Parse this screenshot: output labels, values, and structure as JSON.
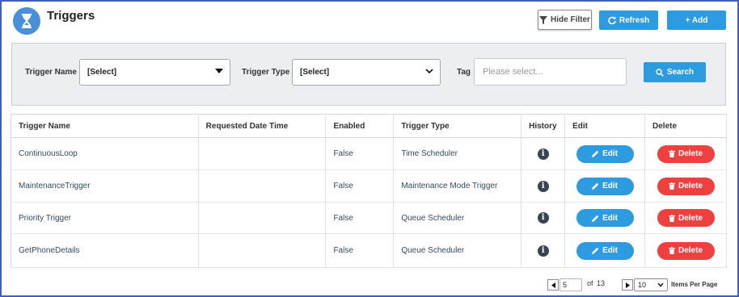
{
  "header": {
    "title": "Triggers",
    "icon": "hourglass-icon",
    "hide_filter_label": "Hide Filter",
    "refresh_label": "Refresh",
    "add_label": "+ Add"
  },
  "filters": {
    "trigger_name_label": "Trigger Name :",
    "trigger_name_value": "[Select]",
    "trigger_type_label": "Trigger Type :",
    "trigger_type_value": "[Select]",
    "tag_label": "Tag :",
    "tag_placeholder": "Please select...",
    "search_label": "Search"
  },
  "table": {
    "headers": [
      "Trigger Name",
      "Requested Date Time",
      "Enabled",
      "Trigger Type",
      "History",
      "Edit",
      "Delete"
    ],
    "rows": [
      {
        "name": "ContinuousLoop",
        "requested": "",
        "enabled": "False",
        "type": "Time Scheduler",
        "edit": "Edit",
        "delete": "Delete"
      },
      {
        "name": "MaintenanceTrigger",
        "requested": "",
        "enabled": "False",
        "type": "Maintenance Mode Trigger",
        "edit": "Edit",
        "delete": "Delete"
      },
      {
        "name": "Priority Trigger",
        "requested": "",
        "enabled": "False",
        "type": "Queue Scheduler",
        "edit": "Edit",
        "delete": "Delete"
      },
      {
        "name": "GetPhoneDetails",
        "requested": "",
        "enabled": "False",
        "type": "Queue Scheduler",
        "edit": "Edit",
        "delete": "Delete"
      }
    ]
  },
  "pagination": {
    "current_page": "5",
    "of_label": "of",
    "total_pages": "13",
    "per_page": "10",
    "per_page_label": "Items Per Page"
  },
  "colors": {
    "primary": "#2d9be0",
    "danger": "#ef4040",
    "frame": "#3f5fbf",
    "panel": "#eceef1"
  }
}
